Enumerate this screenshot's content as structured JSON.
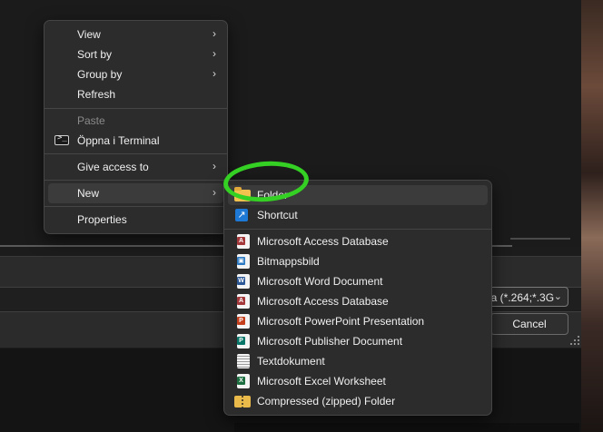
{
  "dialog": {
    "filetype_value": "ia (*.264;*.3G",
    "cancel_label": "Cancel"
  },
  "context_menu": {
    "items": [
      {
        "label": "View",
        "submenu": true
      },
      {
        "label": "Sort by",
        "submenu": true
      },
      {
        "label": "Group by",
        "submenu": true
      },
      {
        "label": "Refresh"
      },
      {
        "label": "Paste",
        "disabled": true
      },
      {
        "label": "Öppna i Terminal",
        "icon": "terminal-icon"
      },
      {
        "label": "Give access to",
        "submenu": true
      },
      {
        "label": "New",
        "submenu": true,
        "active": true
      },
      {
        "label": "Properties"
      }
    ],
    "arrow": "›"
  },
  "new_submenu": {
    "items": [
      {
        "label": "Folder",
        "icon": "folder-icon",
        "active": true
      },
      {
        "label": "Shortcut",
        "icon": "shortcut-icon"
      },
      {
        "label": "Microsoft Access Database",
        "icon": "access-icon"
      },
      {
        "label": "Bitmappsbild",
        "icon": "bitmap-icon"
      },
      {
        "label": "Microsoft Word Document",
        "icon": "word-icon"
      },
      {
        "label": "Microsoft Access Database",
        "icon": "access-icon"
      },
      {
        "label": "Microsoft PowerPoint Presentation",
        "icon": "powerpoint-icon"
      },
      {
        "label": "Microsoft Publisher Document",
        "icon": "publisher-icon"
      },
      {
        "label": "Textdokument",
        "icon": "text-document-icon"
      },
      {
        "label": "Microsoft Excel Worksheet",
        "icon": "excel-icon"
      },
      {
        "label": "Compressed (zipped) Folder",
        "icon": "zip-folder-icon"
      }
    ]
  },
  "colors": {
    "highlight_annotation": "#35d024",
    "menu_bg": "#2c2c2c",
    "access": "#a4373a",
    "word": "#2b5797",
    "powerpoint": "#c43e1c",
    "publisher": "#077568",
    "excel": "#1d6f42"
  }
}
